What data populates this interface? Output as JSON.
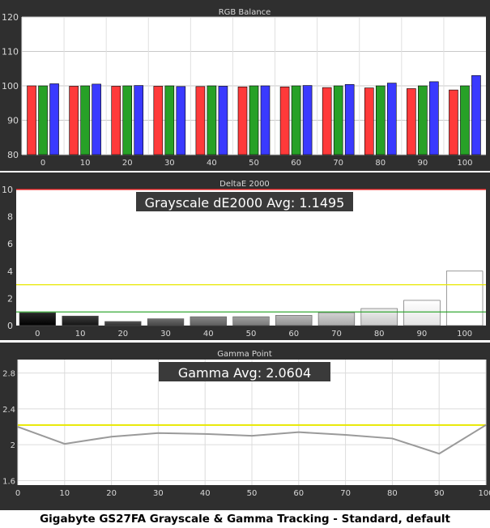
{
  "caption": "Gigabyte GS27FA Grayscale & Gamma Tracking - Standard, default",
  "colors": {
    "panel_bg": "#2f2f2f",
    "plot_bg": "#ffffff",
    "red": "#ff3a3a",
    "green": "#27a127",
    "blue": "#3a3aff",
    "yellow_line": "#e8e800",
    "green_line": "#1f9f1f",
    "red_line": "#ff2020",
    "gamma_line": "#9a9a9a",
    "gamma_target": "#e8e800",
    "text": "#d8d8d8"
  },
  "chart_data": [
    {
      "type": "bar",
      "title": "RGB Balance",
      "categories": [
        "0",
        "10",
        "20",
        "30",
        "40",
        "50",
        "60",
        "70",
        "80",
        "90",
        "100"
      ],
      "yticks": [
        "80",
        "90",
        "100",
        "110",
        "120"
      ],
      "ylim": [
        80,
        120
      ],
      "series": [
        {
          "color_key": "red",
          "values": [
            100.0,
            99.9,
            99.9,
            99.9,
            99.8,
            99.7,
            99.7,
            99.5,
            99.4,
            99.2,
            98.8
          ]
        },
        {
          "color_key": "green",
          "values": [
            100.0,
            100.0,
            100.0,
            100.0,
            100.0,
            100.0,
            100.0,
            100.0,
            100.0,
            100.0,
            100.0
          ]
        },
        {
          "color_key": "blue",
          "values": [
            100.6,
            100.5,
            100.1,
            99.8,
            99.9,
            100.0,
            100.1,
            100.4,
            100.8,
            101.2,
            103.0
          ]
        }
      ],
      "grid": true
    },
    {
      "type": "bar",
      "title": "DeltaE 2000",
      "annotation": "Grayscale dE2000 Avg: 1.1495",
      "categories": [
        "0",
        "10",
        "20",
        "30",
        "40",
        "50",
        "60",
        "70",
        "80",
        "90",
        "100"
      ],
      "yticks": [
        "0",
        "2",
        "4",
        "6",
        "8",
        "10"
      ],
      "ylim": [
        0,
        10
      ],
      "values": [
        0.95,
        0.7,
        0.3,
        0.5,
        0.65,
        0.65,
        0.75,
        0.95,
        1.25,
        1.85,
        4.0
      ],
      "bar_grays": [
        0,
        20,
        45,
        70,
        95,
        120,
        145,
        170,
        200,
        228,
        255
      ],
      "reference_lines": [
        {
          "value": 1,
          "color_key": "green_line"
        },
        {
          "value": 3,
          "color_key": "yellow_line"
        },
        {
          "value": 10,
          "color_key": "red_line"
        }
      ],
      "grid": false
    },
    {
      "type": "line",
      "title": "Gamma Point",
      "annotation": "Gamma Avg: 2.0604",
      "x": [
        0,
        10,
        20,
        30,
        40,
        50,
        60,
        70,
        80,
        90,
        100
      ],
      "y": [
        2.2,
        2.01,
        2.09,
        2.13,
        2.12,
        2.1,
        2.14,
        2.11,
        2.07,
        1.9,
        2.22
      ],
      "target": 2.22,
      "xticks": [
        "0",
        "10",
        "20",
        "30",
        "40",
        "50",
        "60",
        "70",
        "80",
        "90",
        "100"
      ],
      "yticks": [
        "1.6",
        "2",
        "2.4",
        "2.8"
      ],
      "ylim": [
        1.55,
        2.95
      ],
      "xlim": [
        0,
        100
      ],
      "grid": true
    }
  ]
}
